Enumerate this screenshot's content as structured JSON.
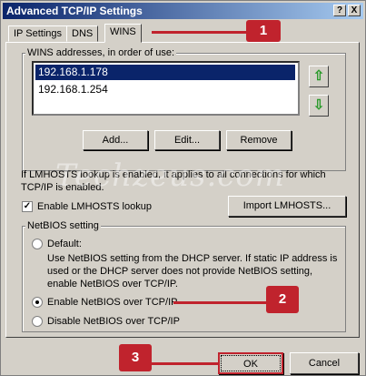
{
  "window": {
    "title": "Advanced TCP/IP Settings",
    "help_glyph": "?",
    "close_glyph": "X"
  },
  "tabs": [
    {
      "label": "IP Settings"
    },
    {
      "label": "DNS"
    },
    {
      "label": "WINS"
    }
  ],
  "wins": {
    "list_label": "WINS addresses, in order of use:",
    "addresses": [
      "192.168.1.178",
      "192.168.1.254"
    ],
    "up_glyph": "⇧",
    "down_glyph": "⇩",
    "add_label": "Add...",
    "edit_label": "Edit...",
    "remove_label": "Remove"
  },
  "lmhosts": {
    "note": "If LMHOSTS lookup is enabled, it applies to all connections for which TCP/IP is enabled.",
    "enable_label": "Enable LMHOSTS lookup",
    "enable_checked": true,
    "import_label": "Import LMHOSTS..."
  },
  "netbios": {
    "group_label": "NetBIOS setting",
    "default_label": "Default:",
    "default_desc": "Use NetBIOS setting from the DHCP server. If static IP address is used or the DHCP server does not provide NetBIOS setting, enable NetBIOS over TCP/IP.",
    "enable_label": "Enable NetBIOS over TCP/IP",
    "disable_label": "Disable NetBIOS over TCP/IP",
    "selected": "enable"
  },
  "footer": {
    "ok_label": "OK",
    "cancel_label": "Cancel"
  },
  "markers": [
    "1",
    "2",
    "3"
  ],
  "watermark": "Techzeus.com",
  "colors": {
    "title_start": "#0a246a",
    "title_end": "#a6caf0",
    "marker": "#c0232d",
    "selection": "#0a246a",
    "arrow": "#2a9a2a"
  }
}
